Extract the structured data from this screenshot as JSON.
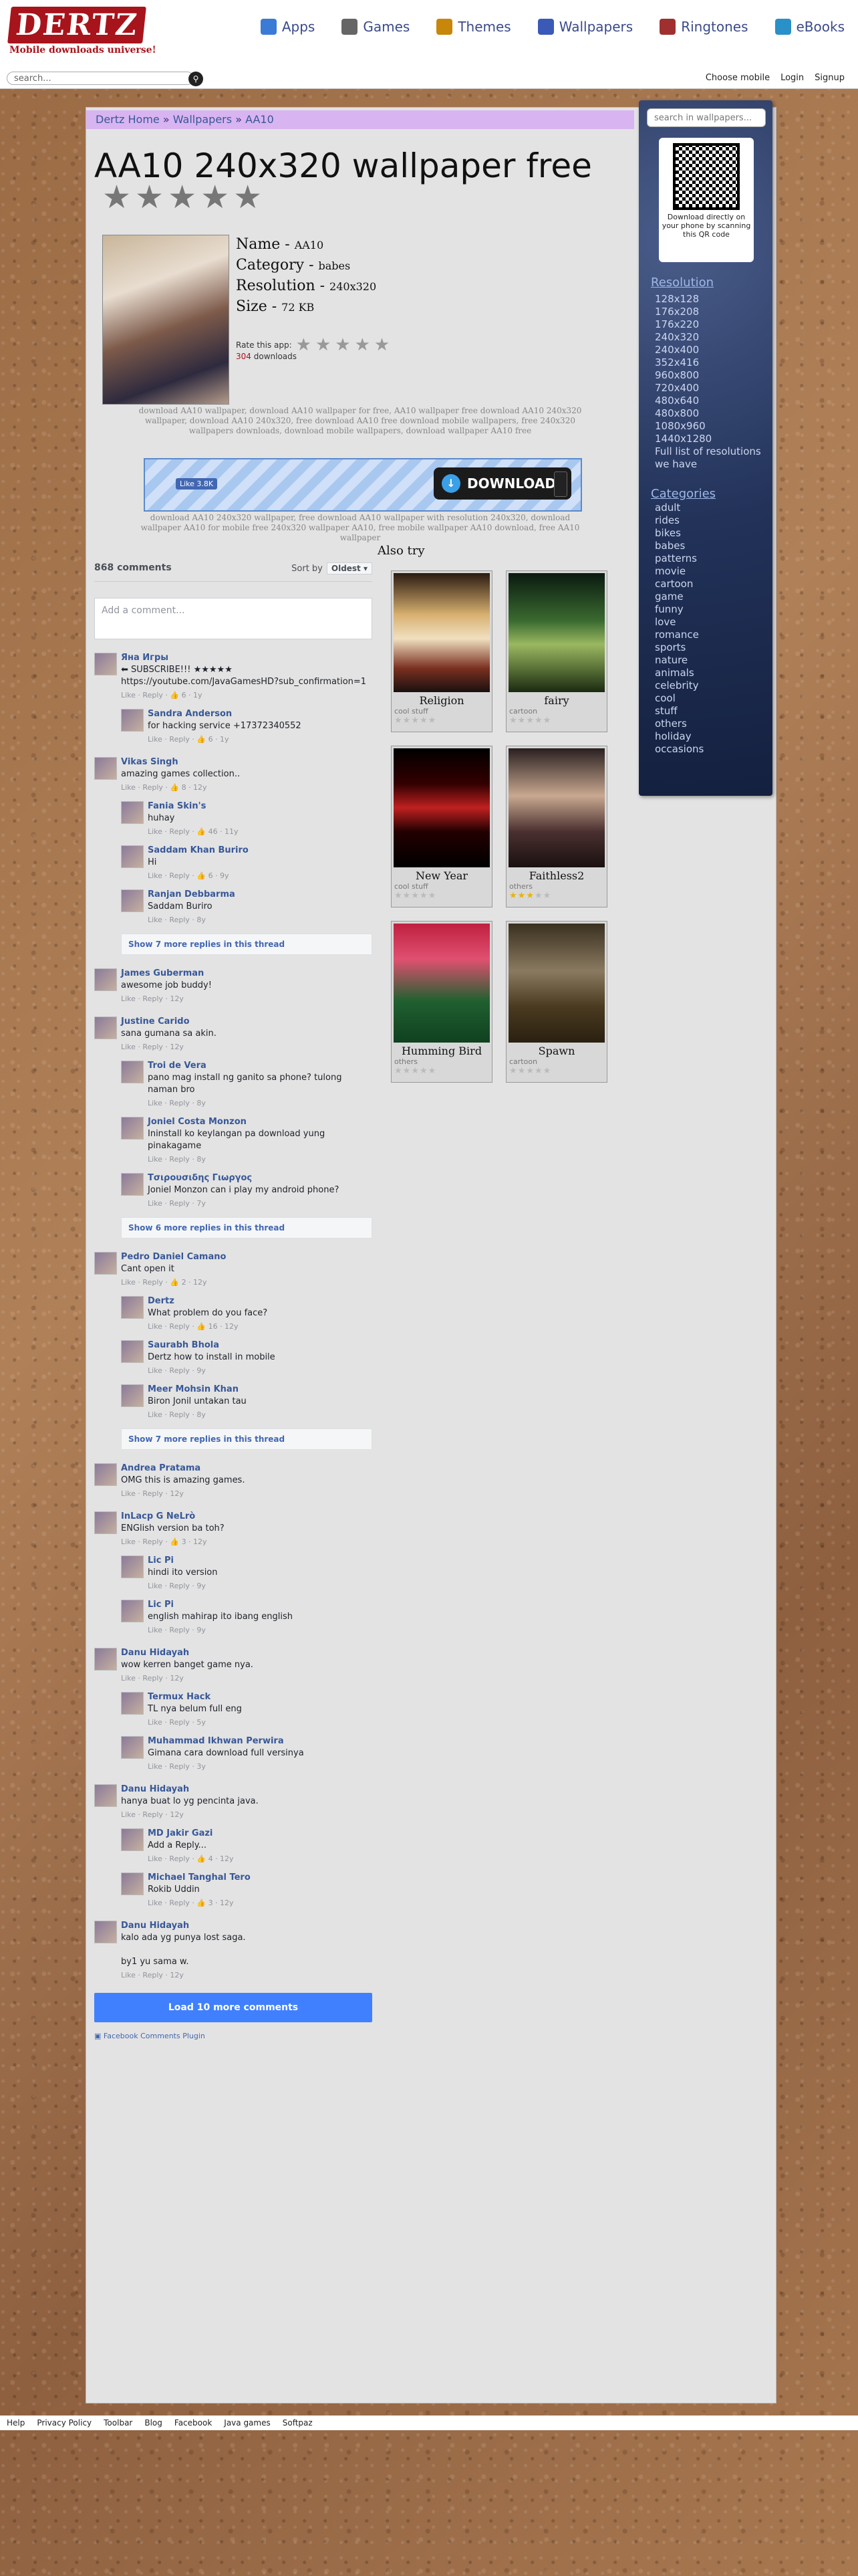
{
  "header": {
    "logo": "DERTZ",
    "tagline": "Mobile downloads universe!",
    "nav": [
      {
        "label": "Apps",
        "icon": "apps-icon",
        "color": "#3a7bd5"
      },
      {
        "label": "Games",
        "icon": "games-icon",
        "color": "#666666"
      },
      {
        "label": "Themes",
        "icon": "themes-icon",
        "color": "#c8860a"
      },
      {
        "label": "Wallpapers",
        "icon": "wallpapers-icon",
        "color": "#3b5ab8"
      },
      {
        "label": "Ringtones",
        "icon": "ringtones-icon",
        "color": "#a03030"
      },
      {
        "label": "eBooks",
        "icon": "ebooks-icon",
        "color": "#2a90c8"
      }
    ]
  },
  "topbar": {
    "search_placeholder": "search...",
    "links": [
      "Choose mobile",
      "Login",
      "Signup"
    ]
  },
  "breadcrumb": [
    "Dertz Home",
    "Wallpapers",
    "AA10"
  ],
  "page": {
    "title": "AA10 240x320 wallpaper free",
    "name_label": "Name -",
    "name": "AA10",
    "category_label": "Category -",
    "category": "babes",
    "resolution_label": "Resolution -",
    "resolution": "240x320",
    "size_label": "Size -",
    "size": "72 KB",
    "rate_label": "Rate this app:",
    "downloads_count": "304",
    "downloads_label": "downloads",
    "keywords1": "download AA10 wallpaper, download AA10 wallpaper for free, AA10 wallpaper free download AA10 240x320 wallpaper, download AA10 240x320, free download AA10 free download mobile wallpapers, free 240x320 wallpapers downloads, download mobile wallpapers, download wallpaper AA10 free",
    "download_button": "DOWNLOAD",
    "fb_like": "Like 3.8K",
    "keywords2": "download AA10 240x320 wallpaper, free download AA10 wallpaper with resolution 240x320, download wallpaper AA10 for mobile free 240x320 wallpaper AA10, free mobile wallpaper AA10 download, free AA10 wallpaper"
  },
  "comments": {
    "count": "868 comments",
    "sort_label": "Sort by",
    "sort_value": "Oldest",
    "add_placeholder": "Add a comment...",
    "load_more": "Load 10 more comments",
    "plugin": "Facebook Comments Plugin",
    "threads": [
      {
        "name": "Яна Игры",
        "text": "⬅ SUBSCRIBE!!! ★★★★★ https://youtube.com/JavaGamesHD?sub_confirmation=1",
        "meta": "Like · Reply · 👍 6 · 1y",
        "replies": [
          {
            "name": "Sandra Anderson",
            "text": "for hacking service +17372340552",
            "meta": "Like · Reply · 👍 6 · 1y"
          }
        ]
      },
      {
        "name": "Vikas Singh",
        "text": "amazing games collection..",
        "meta": "Like · Reply · 👍 8 · 12y",
        "replies": [
          {
            "name": "Fania Skin's",
            "text": "huhay",
            "meta": "Like · Reply · 👍 46 · 11y"
          },
          {
            "name": "Saddam Khan Buriro",
            "text": "Hi",
            "meta": "Like · Reply · 👍 6 · 9y"
          },
          {
            "name": "Ranjan Debbarma",
            "text": "Saddam Buriro",
            "meta": "Like · Reply · 8y"
          }
        ],
        "more": "Show 7 more replies in this thread"
      },
      {
        "name": "James Guberman",
        "text": "awesome job buddy!",
        "meta": "Like · Reply · 12y",
        "replies": []
      },
      {
        "name": "Justine Carido",
        "text": "sana gumana sa akin.",
        "meta": "Like · Reply · 12y",
        "replies": [
          {
            "name": "Troi de Vera",
            "text": "pano mag install ng ganito sa phone? tulong naman bro",
            "meta": "Like · Reply · 8y"
          },
          {
            "name": "Joniel Costa Monzon",
            "text": "Ininstall ko keylangan pa download yung pinakagame",
            "meta": "Like · Reply · 8y"
          },
          {
            "name": "Τσιρουσιδης Γιωργος",
            "text": "Joniel Monzon can i play my android phone?",
            "meta": "Like · Reply · 7y"
          }
        ],
        "more": "Show 6 more replies in this thread"
      },
      {
        "name": "Pedro Daniel Camano",
        "text": "Cant open it",
        "meta": "Like · Reply · 👍 2 · 12y",
        "replies": [
          {
            "name": "Dertz",
            "text": "What problem do you face?",
            "meta": "Like · Reply · 👍 16 · 12y"
          },
          {
            "name": "Saurabh Bhola",
            "text": "Dertz how to install in mobile",
            "meta": "Like · Reply · 9y"
          },
          {
            "name": "Meer Mohsin Khan",
            "text": "Biron Jonil untakan tau",
            "meta": "Like · Reply · 8y"
          }
        ],
        "more": "Show 7 more replies in this thread"
      },
      {
        "name": "Andrea Pratama",
        "text": "OMG this is amazing games.",
        "meta": "Like · Reply · 12y",
        "replies": []
      },
      {
        "name": "InLacp G NeLrò",
        "text": "ENGlish version ba toh?",
        "meta": "Like · Reply · 👍 3 · 12y",
        "replies": [
          {
            "name": "Lic Pi",
            "text": "hindi ito version",
            "meta": "Like · Reply · 9y"
          },
          {
            "name": "Lic Pi",
            "text": "english mahirap ito ibang english",
            "meta": "Like · Reply · 9y"
          }
        ]
      },
      {
        "name": "Danu Hidayah",
        "text": "wow kerren banget game nya.",
        "meta": "Like · Reply · 12y",
        "replies": [
          {
            "name": "Termux Hack",
            "text": "TL nya belum full eng",
            "meta": "Like · Reply · 5y"
          },
          {
            "name": "Muhammad Ikhwan Perwira",
            "text": "Gimana cara download full versinya",
            "meta": "Like · Reply · 3y"
          }
        ]
      },
      {
        "name": "Danu Hidayah",
        "text": "hanya buat lo yg pencinta java.",
        "meta": "Like · Reply · 12y",
        "replies": [
          {
            "name": "MD Jakir Gazi",
            "text": "Add a Reply...",
            "meta": "Like · Reply · 👍 4 · 12y"
          },
          {
            "name": "Michael Tanghal Tero",
            "text": "Rokib Uddin",
            "meta": "Like · Reply · 👍 3 · 12y"
          }
        ]
      },
      {
        "name": "Danu Hidayah",
        "text": "kalo ada yg punya lost saga.\n\nby1 yu sama w.",
        "meta": "Like · Reply · 12y",
        "replies": []
      }
    ]
  },
  "also_try": {
    "title": "Also try",
    "cards": [
      {
        "title": "Religion",
        "cat": "cool stuff",
        "rating": 0,
        "gradient": "linear-gradient(180deg,#2a1a10 0%,#d8b070 35%,#f0e0c0 55%,#7a3020 80%,#1a1010 100%)"
      },
      {
        "title": "fairy",
        "cat": "cartoon",
        "rating": 0,
        "gradient": "linear-gradient(180deg,#0a1a10 0%,#3a6a30 40%,#9ab860 60%,#1a2a10 100%)"
      },
      {
        "title": "New Year",
        "cat": "cool stuff",
        "rating": 0,
        "gradient": "linear-gradient(180deg,#000 0%,#300 30%,#c02020 50%,#200 70%,#000 100%)"
      },
      {
        "title": "Faithless2",
        "cat": "others",
        "rating": 3,
        "gradient": "linear-gradient(180deg,#2a2020 0%,#c8a890 40%,#4a3030 70%,#1a1010 100%)"
      },
      {
        "title": "Humming Bird",
        "cat": "others",
        "rating": 0,
        "gradient": "linear-gradient(180deg,#c02040 0%,#e05070 30%,#206030 65%,#104020 100%)"
      },
      {
        "title": "Spawn",
        "cat": "cartoon",
        "rating": 0,
        "gradient": "linear-gradient(180deg,#3a3020 0%,#8a7a60 40%,#4a3a20 70%,#2a2010 100%)"
      }
    ]
  },
  "sidebar": {
    "search_placeholder": "search in wallpapers...",
    "qr_text": "Download directly on your phone by scanning this QR code",
    "resolution_title": "Resolution",
    "resolutions": [
      "128x128",
      "176x208",
      "176x220",
      "240x320",
      "240x400",
      "352x416",
      "960x800",
      "720x400",
      "480x640",
      "480x800",
      "1080x960",
      "1440x1280",
      "Full list of resolutions we have"
    ],
    "categories_title": "Categories",
    "categories": [
      "adult",
      "rides",
      "bikes",
      "babes",
      "patterns",
      "movie",
      "cartoon",
      "game",
      "funny",
      "love",
      "romance",
      "sports",
      "nature",
      "animals",
      "celebrity",
      "cool",
      "stuff",
      "others",
      "holiday",
      "occasions"
    ]
  },
  "footer": {
    "links": [
      "Help",
      "Privacy Policy",
      "Toolbar",
      "Blog",
      "Facebook",
      "Java games",
      "Softpaz"
    ]
  }
}
